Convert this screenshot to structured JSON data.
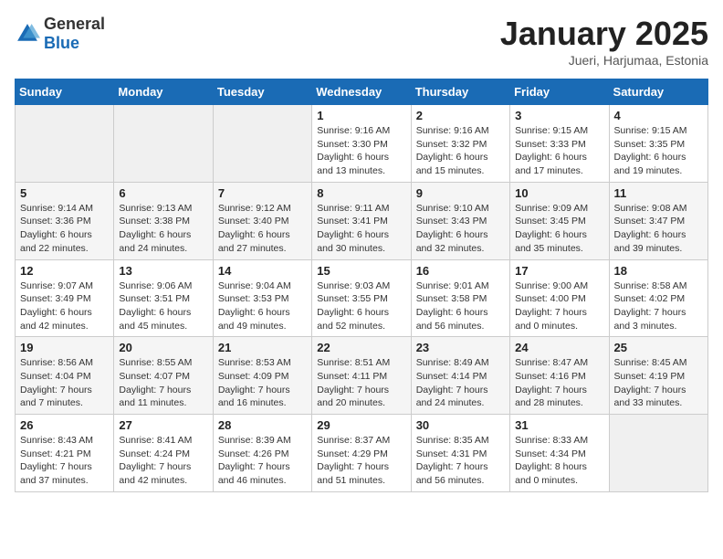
{
  "header": {
    "logo_general": "General",
    "logo_blue": "Blue",
    "title": "January 2025",
    "location": "Jueri, Harjumaa, Estonia"
  },
  "weekdays": [
    "Sunday",
    "Monday",
    "Tuesday",
    "Wednesday",
    "Thursday",
    "Friday",
    "Saturday"
  ],
  "weeks": [
    {
      "row": 1,
      "days": [
        {
          "num": "",
          "info": ""
        },
        {
          "num": "",
          "info": ""
        },
        {
          "num": "",
          "info": ""
        },
        {
          "num": "1",
          "info": "Sunrise: 9:16 AM\nSunset: 3:30 PM\nDaylight: 6 hours\nand 13 minutes."
        },
        {
          "num": "2",
          "info": "Sunrise: 9:16 AM\nSunset: 3:32 PM\nDaylight: 6 hours\nand 15 minutes."
        },
        {
          "num": "3",
          "info": "Sunrise: 9:15 AM\nSunset: 3:33 PM\nDaylight: 6 hours\nand 17 minutes."
        },
        {
          "num": "4",
          "info": "Sunrise: 9:15 AM\nSunset: 3:35 PM\nDaylight: 6 hours\nand 19 minutes."
        }
      ]
    },
    {
      "row": 2,
      "days": [
        {
          "num": "5",
          "info": "Sunrise: 9:14 AM\nSunset: 3:36 PM\nDaylight: 6 hours\nand 22 minutes."
        },
        {
          "num": "6",
          "info": "Sunrise: 9:13 AM\nSunset: 3:38 PM\nDaylight: 6 hours\nand 24 minutes."
        },
        {
          "num": "7",
          "info": "Sunrise: 9:12 AM\nSunset: 3:40 PM\nDaylight: 6 hours\nand 27 minutes."
        },
        {
          "num": "8",
          "info": "Sunrise: 9:11 AM\nSunset: 3:41 PM\nDaylight: 6 hours\nand 30 minutes."
        },
        {
          "num": "9",
          "info": "Sunrise: 9:10 AM\nSunset: 3:43 PM\nDaylight: 6 hours\nand 32 minutes."
        },
        {
          "num": "10",
          "info": "Sunrise: 9:09 AM\nSunset: 3:45 PM\nDaylight: 6 hours\nand 35 minutes."
        },
        {
          "num": "11",
          "info": "Sunrise: 9:08 AM\nSunset: 3:47 PM\nDaylight: 6 hours\nand 39 minutes."
        }
      ]
    },
    {
      "row": 3,
      "days": [
        {
          "num": "12",
          "info": "Sunrise: 9:07 AM\nSunset: 3:49 PM\nDaylight: 6 hours\nand 42 minutes."
        },
        {
          "num": "13",
          "info": "Sunrise: 9:06 AM\nSunset: 3:51 PM\nDaylight: 6 hours\nand 45 minutes."
        },
        {
          "num": "14",
          "info": "Sunrise: 9:04 AM\nSunset: 3:53 PM\nDaylight: 6 hours\nand 49 minutes."
        },
        {
          "num": "15",
          "info": "Sunrise: 9:03 AM\nSunset: 3:55 PM\nDaylight: 6 hours\nand 52 minutes."
        },
        {
          "num": "16",
          "info": "Sunrise: 9:01 AM\nSunset: 3:58 PM\nDaylight: 6 hours\nand 56 minutes."
        },
        {
          "num": "17",
          "info": "Sunrise: 9:00 AM\nSunset: 4:00 PM\nDaylight: 7 hours\nand 0 minutes."
        },
        {
          "num": "18",
          "info": "Sunrise: 8:58 AM\nSunset: 4:02 PM\nDaylight: 7 hours\nand 3 minutes."
        }
      ]
    },
    {
      "row": 4,
      "days": [
        {
          "num": "19",
          "info": "Sunrise: 8:56 AM\nSunset: 4:04 PM\nDaylight: 7 hours\nand 7 minutes."
        },
        {
          "num": "20",
          "info": "Sunrise: 8:55 AM\nSunset: 4:07 PM\nDaylight: 7 hours\nand 11 minutes."
        },
        {
          "num": "21",
          "info": "Sunrise: 8:53 AM\nSunset: 4:09 PM\nDaylight: 7 hours\nand 16 minutes."
        },
        {
          "num": "22",
          "info": "Sunrise: 8:51 AM\nSunset: 4:11 PM\nDaylight: 7 hours\nand 20 minutes."
        },
        {
          "num": "23",
          "info": "Sunrise: 8:49 AM\nSunset: 4:14 PM\nDaylight: 7 hours\nand 24 minutes."
        },
        {
          "num": "24",
          "info": "Sunrise: 8:47 AM\nSunset: 4:16 PM\nDaylight: 7 hours\nand 28 minutes."
        },
        {
          "num": "25",
          "info": "Sunrise: 8:45 AM\nSunset: 4:19 PM\nDaylight: 7 hours\nand 33 minutes."
        }
      ]
    },
    {
      "row": 5,
      "days": [
        {
          "num": "26",
          "info": "Sunrise: 8:43 AM\nSunset: 4:21 PM\nDaylight: 7 hours\nand 37 minutes."
        },
        {
          "num": "27",
          "info": "Sunrise: 8:41 AM\nSunset: 4:24 PM\nDaylight: 7 hours\nand 42 minutes."
        },
        {
          "num": "28",
          "info": "Sunrise: 8:39 AM\nSunset: 4:26 PM\nDaylight: 7 hours\nand 46 minutes."
        },
        {
          "num": "29",
          "info": "Sunrise: 8:37 AM\nSunset: 4:29 PM\nDaylight: 7 hours\nand 51 minutes."
        },
        {
          "num": "30",
          "info": "Sunrise: 8:35 AM\nSunset: 4:31 PM\nDaylight: 7 hours\nand 56 minutes."
        },
        {
          "num": "31",
          "info": "Sunrise: 8:33 AM\nSunset: 4:34 PM\nDaylight: 8 hours\nand 0 minutes."
        },
        {
          "num": "",
          "info": ""
        }
      ]
    }
  ]
}
